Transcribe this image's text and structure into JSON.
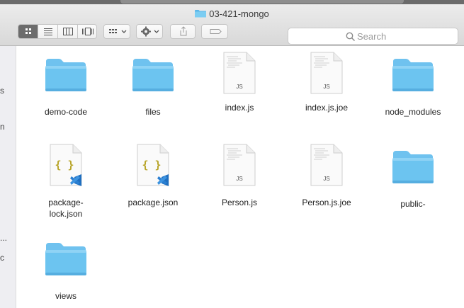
{
  "window": {
    "title": "03-421-mongo"
  },
  "toolbar": {
    "view_modes": [
      "icon-view",
      "list-view",
      "column-view",
      "cover-flow-view"
    ],
    "group_button": "group-by",
    "action_button": "action-gear",
    "share_button": "share",
    "tags_button": "tags"
  },
  "search": {
    "placeholder": "Search"
  },
  "sidebar": {
    "fragments": [
      "s",
      "n",
      "...",
      "c"
    ]
  },
  "files": [
    {
      "name": "demo-code",
      "kind": "folder"
    },
    {
      "name": "files",
      "kind": "folder"
    },
    {
      "name": "index.js",
      "kind": "js",
      "badge": "JS"
    },
    {
      "name": "index.js.joe",
      "kind": "js",
      "badge": "JS"
    },
    {
      "name": "node_modules",
      "kind": "folder"
    },
    {
      "name": "package-\nlock.json",
      "kind": "json",
      "badge": "{ }"
    },
    {
      "name": "package.json",
      "kind": "json",
      "badge": "{ }"
    },
    {
      "name": "Person.js",
      "kind": "js",
      "badge": "JS"
    },
    {
      "name": "Person.js.joe",
      "kind": "js",
      "badge": "JS"
    },
    {
      "name": "public-",
      "kind": "folder"
    },
    {
      "name": "views",
      "kind": "folder"
    }
  ],
  "colors": {
    "folder_top": "#7ccdf2",
    "folder_body": "#5ab6e8",
    "vscode_blue": "#2a7fd1",
    "json_braces": "#b8a52a"
  }
}
